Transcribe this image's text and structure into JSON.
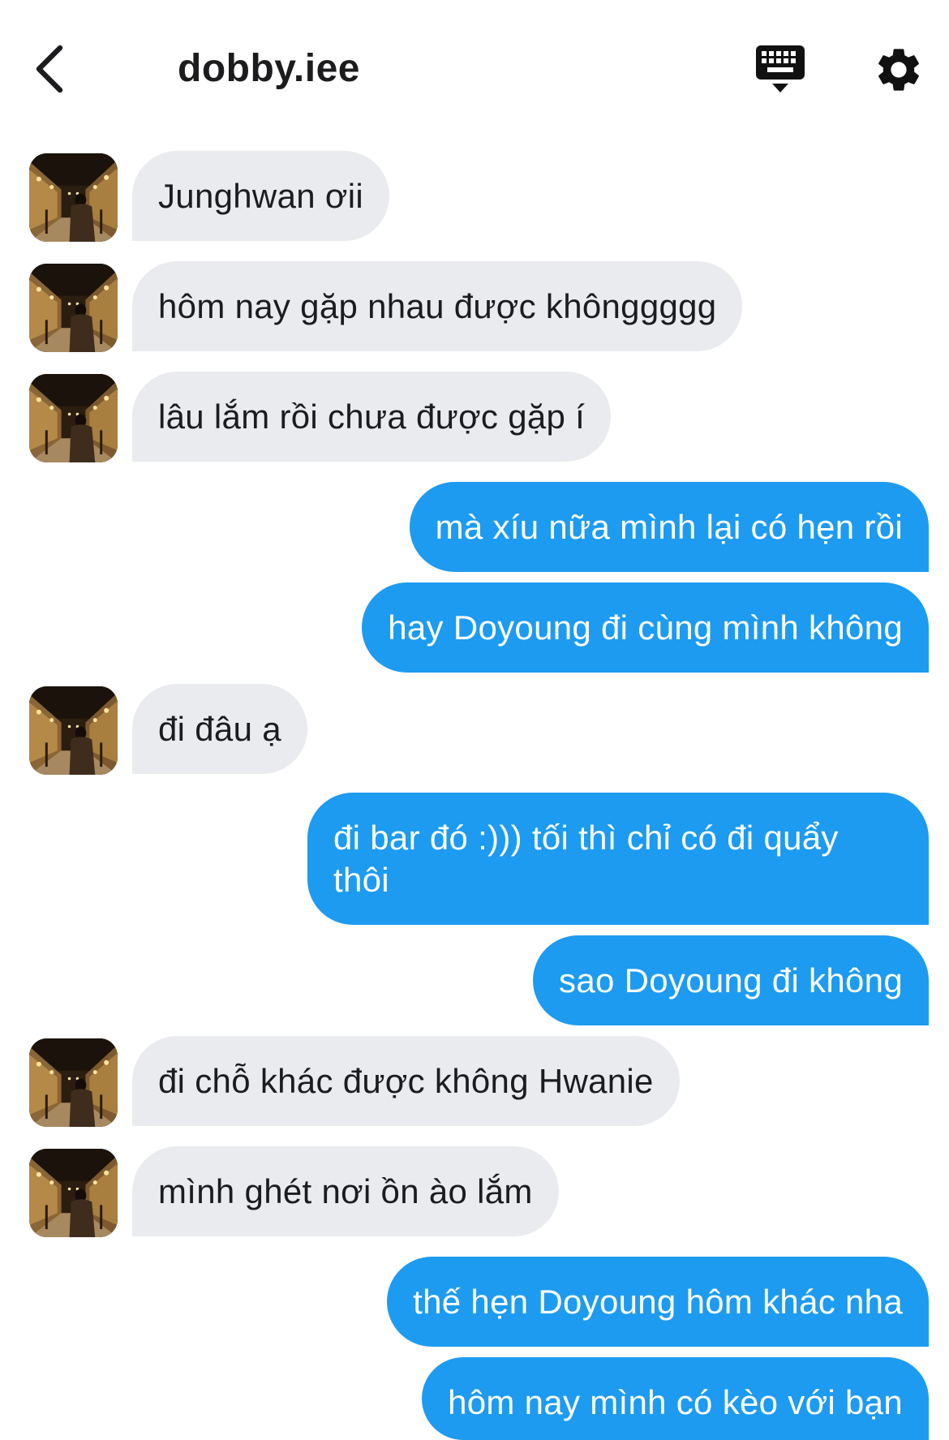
{
  "header": {
    "title": "dobby.iee",
    "back_icon": "chevron-left-icon",
    "keyboard_icon": "keyboard-icon",
    "settings_icon": "gear-icon"
  },
  "colors": {
    "incoming_bubble": "#e9ebee",
    "outgoing_bubble": "#1d9bf0",
    "outgoing_text": "#ffffff",
    "incoming_text": "#1c1c1e"
  },
  "messages": [
    {
      "from": "them",
      "text": "Junghwan ơii"
    },
    {
      "from": "them",
      "text": "hôm nay gặp nhau được khônggggg"
    },
    {
      "from": "them",
      "text": "lâu lắm rồi chưa được gặp í"
    },
    {
      "from": "me",
      "text": "mà xíu nữa mình lại có hẹn rồi"
    },
    {
      "from": "me",
      "text": "hay Doyoung đi cùng mình không"
    },
    {
      "from": "them",
      "text": "đi đâu ạ"
    },
    {
      "from": "me",
      "text": "đi bar đó :))) tối thì chỉ có đi quẩy thôi"
    },
    {
      "from": "me",
      "text": "sao Doyoung đi không"
    },
    {
      "from": "them",
      "text": "đi chỗ khác được không Hwanie"
    },
    {
      "from": "them",
      "text": "mình ghét nơi ồn ào lắm"
    },
    {
      "from": "me",
      "text": "thế hẹn Doyoung hôm khác nha"
    },
    {
      "from": "me",
      "text": "hôm nay mình có kèo với bạn"
    }
  ]
}
